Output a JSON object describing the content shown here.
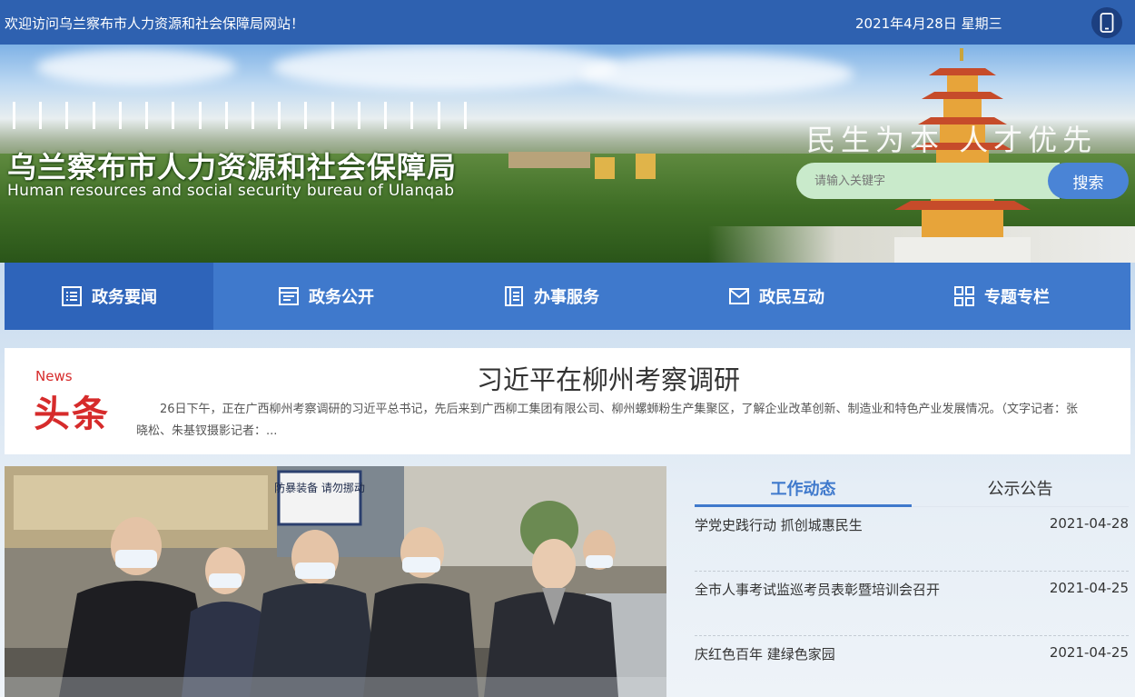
{
  "topbar": {
    "welcome": "欢迎访问乌兰察布市人力资源和社会保障局网站！",
    "date": "2021年4月28日 星期三",
    "mobile_icon": "mobile-phone-icon"
  },
  "header": {
    "title": "乌兰察布市人力资源和社会保障局",
    "subtitle": "Human resources and social security bureau of Ulanqab",
    "slogan": "民生为本 人才优先"
  },
  "search": {
    "placeholder": "请输入关键字",
    "button_label": "搜索"
  },
  "nav": {
    "items": [
      {
        "label": "政务要闻",
        "icon": "news-list-icon"
      },
      {
        "label": "政务公开",
        "icon": "open-doc-icon"
      },
      {
        "label": "办事服务",
        "icon": "service-doc-icon"
      },
      {
        "label": "政民互动",
        "icon": "mail-icon"
      },
      {
        "label": "专题专栏",
        "icon": "grid-icon"
      }
    ]
  },
  "headline": {
    "badge_en": "News",
    "badge_cn": "头条",
    "title": "习近平在柳州考察调研",
    "summary": "26日下午，正在广西柳州考察调研的习近平总书记，先后来到广西柳工集团有限公司、柳州螺蛳粉生产集聚区，了解企业改革创新、制造业和特色产业发展情况。（文字记者：张晓松、朱基钗摄影记者：..."
  },
  "photo": {
    "sign_text": "防暴装备 请勿挪动"
  },
  "tabs": [
    {
      "label": "工作动态"
    },
    {
      "label": "公示公告"
    }
  ],
  "news_list": [
    {
      "title": "学党史践行动 抓创城惠民生",
      "date": "2021-04-28"
    },
    {
      "title": "全市人事考试监巡考员表彰暨培训会召开",
      "date": "2021-04-25"
    },
    {
      "title": "庆红色百年 建绿色家园",
      "date": "2021-04-25"
    }
  ],
  "colors": {
    "primary": "#2e61b0",
    "nav": "#3f79cc",
    "accent_red": "#d62b2b"
  }
}
